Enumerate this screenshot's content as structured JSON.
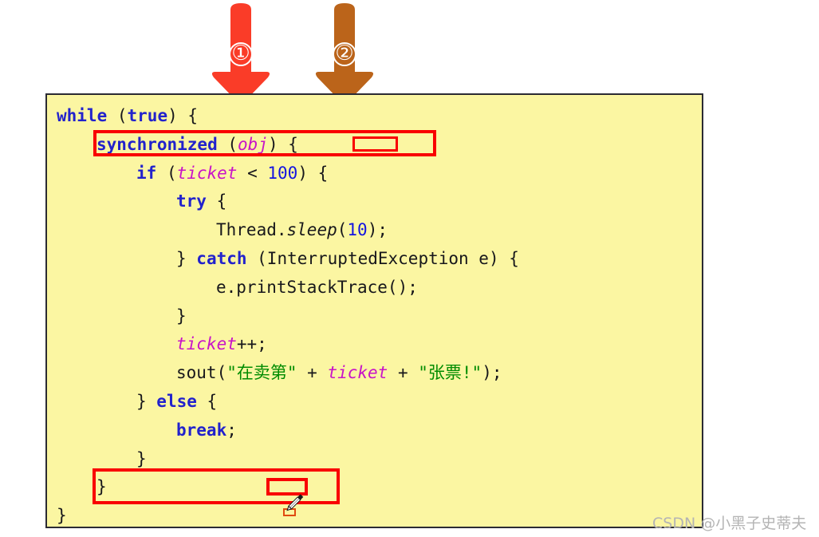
{
  "annotations": {
    "arrows": [
      {
        "name": "arrow-one",
        "label": "①",
        "color": "#fa3c28"
      },
      {
        "name": "arrow-two",
        "label": "②",
        "color": "#bb641a"
      }
    ],
    "highlight_color": "#f90000",
    "marker_color": "#e04a10"
  },
  "code": {
    "background": "#fbf6a2",
    "border_color": "#2b2b33",
    "lines": [
      {
        "id": "line-while",
        "indent": 0,
        "tokens": [
          {
            "t": "while",
            "c": "kw"
          },
          {
            "t": " (",
            "c": "plain"
          },
          {
            "t": "true",
            "c": "kw"
          },
          {
            "t": ") {",
            "c": "plain"
          }
        ]
      },
      {
        "id": "line-synchronized",
        "indent": 1,
        "tokens": [
          {
            "t": "synchronized",
            "c": "kw"
          },
          {
            "t": " (",
            "c": "plain"
          },
          {
            "t": "obj",
            "c": "field"
          },
          {
            "t": ") {",
            "c": "plain"
          }
        ]
      },
      {
        "id": "line-if",
        "indent": 2,
        "tokens": [
          {
            "t": "if",
            "c": "kw"
          },
          {
            "t": " (",
            "c": "plain"
          },
          {
            "t": "ticket",
            "c": "field"
          },
          {
            "t": " < ",
            "c": "plain"
          },
          {
            "t": "100",
            "c": "num"
          },
          {
            "t": ") {",
            "c": "plain"
          }
        ]
      },
      {
        "id": "line-try",
        "indent": 3,
        "tokens": [
          {
            "t": "try",
            "c": "kw"
          },
          {
            "t": " {",
            "c": "plain"
          }
        ]
      },
      {
        "id": "line-sleep",
        "indent": 4,
        "tokens": [
          {
            "t": "Thread.",
            "c": "plain"
          },
          {
            "t": "sleep",
            "c": "stat"
          },
          {
            "t": "(",
            "c": "plain"
          },
          {
            "t": "10",
            "c": "num"
          },
          {
            "t": ");",
            "c": "plain"
          }
        ]
      },
      {
        "id": "line-catch",
        "indent": 3,
        "tokens": [
          {
            "t": "} ",
            "c": "plain"
          },
          {
            "t": "catch",
            "c": "kw"
          },
          {
            "t": " (InterruptedException e) {",
            "c": "plain"
          }
        ]
      },
      {
        "id": "line-printstacktrace",
        "indent": 4,
        "tokens": [
          {
            "t": "e.printStackTrace();",
            "c": "plain"
          }
        ]
      },
      {
        "id": "line-try-close",
        "indent": 3,
        "tokens": [
          {
            "t": "}",
            "c": "plain"
          }
        ]
      },
      {
        "id": "line-ticket-increment",
        "indent": 3,
        "tokens": [
          {
            "t": "ticket",
            "c": "field"
          },
          {
            "t": "++;",
            "c": "plain"
          }
        ]
      },
      {
        "id": "line-sout",
        "indent": 3,
        "tokens": [
          {
            "t": "sout(",
            "c": "plain"
          },
          {
            "t": "\"在卖第\"",
            "c": "str"
          },
          {
            "t": " + ",
            "c": "plain"
          },
          {
            "t": "ticket",
            "c": "field"
          },
          {
            "t": " + ",
            "c": "plain"
          },
          {
            "t": "\"张票!\"",
            "c": "str"
          },
          {
            "t": ");",
            "c": "plain"
          }
        ]
      },
      {
        "id": "line-else",
        "indent": 2,
        "tokens": [
          {
            "t": "} ",
            "c": "plain"
          },
          {
            "t": "else",
            "c": "kw"
          },
          {
            "t": " {",
            "c": "plain"
          }
        ]
      },
      {
        "id": "line-break",
        "indent": 3,
        "tokens": [
          {
            "t": "break",
            "c": "kw"
          },
          {
            "t": ";",
            "c": "plain"
          }
        ]
      },
      {
        "id": "line-else-close",
        "indent": 2,
        "tokens": [
          {
            "t": "}",
            "c": "plain"
          }
        ]
      },
      {
        "id": "line-sync-close",
        "indent": 1,
        "tokens": [
          {
            "t": "}",
            "c": "plain"
          }
        ]
      },
      {
        "id": "line-while-close",
        "indent": 0,
        "tokens": [
          {
            "t": "}",
            "c": "plain"
          }
        ]
      }
    ]
  },
  "watermark": {
    "text": "CSDN @小黑子史蒂夫"
  }
}
